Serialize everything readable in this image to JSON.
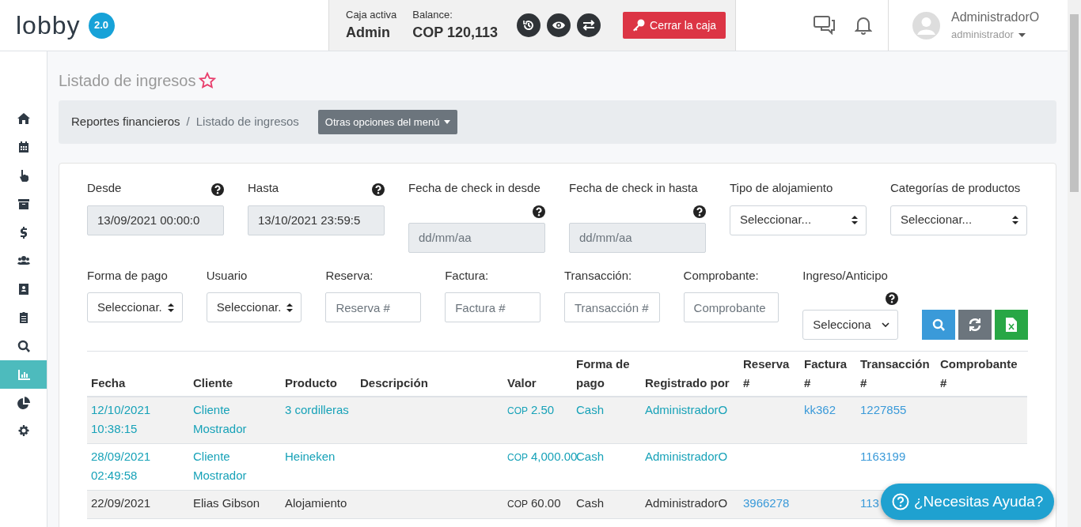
{
  "header": {
    "logo": "lobby",
    "version": "2.0",
    "cash_label": "Caja activa",
    "cash_value": "Admin",
    "balance_label": "Balance:",
    "balance_value": "COP 120,113",
    "close_button": "Cerrar la caja",
    "user_name": "AdministradorO",
    "user_role": "administrador"
  },
  "sidebar": {
    "items": [
      {
        "selected": false
      },
      {
        "selected": false
      },
      {
        "selected": false
      },
      {
        "selected": false
      },
      {
        "selected": false
      },
      {
        "selected": false
      },
      {
        "selected": false
      },
      {
        "selected": false
      },
      {
        "selected": false
      },
      {
        "selected": true
      },
      {
        "selected": false
      },
      {
        "selected": false
      }
    ]
  },
  "page": {
    "title": "Listado de ingresos",
    "favorite": false,
    "breadcrumb": [
      "Reportes financieros",
      "Listado de ingresos"
    ],
    "breadcrumb_separator": "/",
    "menu_button": "Otras opciones del menú"
  },
  "filters_row_1": [
    {
      "kind": "input",
      "label": "Desde",
      "help": true,
      "value": "13/09/2021 00:00:0",
      "readonly": true
    },
    {
      "kind": "input",
      "label": "Hasta",
      "help": true,
      "value": "13/10/2021 23:59:5",
      "readonly": true
    },
    {
      "kind": "input",
      "label": "Fecha de check in desde",
      "help": true,
      "placeholder": "dd/mm/aa",
      "readonly": true
    },
    {
      "kind": "input",
      "label": "Fecha de check in hasta",
      "help": true,
      "placeholder": "dd/mm/aa",
      "readonly": true
    },
    {
      "kind": "select",
      "label": "Tipo de alojamiento",
      "help": false,
      "value": "Seleccionar..."
    },
    {
      "kind": "select",
      "label": "Categorías de productos",
      "help": false,
      "value": "Seleccionar..."
    }
  ],
  "filters_row_2": [
    {
      "kind": "select",
      "label": "Forma de pago",
      "help": false,
      "value": "Seleccionar."
    },
    {
      "kind": "select",
      "label": "Usuario",
      "help": false,
      "value": "Seleccionar."
    },
    {
      "kind": "input",
      "label": "Reserva:",
      "help": false,
      "placeholder": "Reserva #",
      "readonly": false
    },
    {
      "kind": "input",
      "label": "Factura:",
      "help": false,
      "placeholder": "Factura #",
      "readonly": false
    },
    {
      "kind": "input",
      "label": "Transacción:",
      "help": false,
      "placeholder": "Transacción #",
      "readonly": false
    },
    {
      "kind": "input",
      "label": "Comprobante:",
      "help": false,
      "placeholder": "Comprobante",
      "readonly": false
    },
    {
      "kind": "dropdown",
      "label": "Ingreso/Anticipo",
      "help": true,
      "value": "Selecciona"
    }
  ],
  "table": {
    "columns": [
      "Fecha",
      "Cliente",
      "Producto",
      "Descripción",
      "Valor",
      "Forma de pago",
      "Registrado por",
      "Reserva #",
      "Factura #",
      "Transacción #",
      "Comprobante #"
    ],
    "rows": [
      {
        "linked": true,
        "fecha": "12/10/2021 10:38:15",
        "cliente": "Cliente Mostrador",
        "producto": "3 cordilleras",
        "descripcion": "",
        "currency": "COP",
        "amount": "2.50",
        "forma": "Cash",
        "registrado": "AdministradorO",
        "reserva": "",
        "factura": "kk362",
        "transaccion": "1227855",
        "comprobante": ""
      },
      {
        "linked": true,
        "fecha": "28/09/2021 02:49:58",
        "cliente": "Cliente Mostrador",
        "producto": "Heineken",
        "descripcion": "",
        "currency": "COP",
        "amount": "4,000.00",
        "forma": "Cash",
        "registrado": "AdministradorO",
        "reserva": "",
        "factura": "",
        "transaccion": "1163199",
        "comprobante": ""
      },
      {
        "linked": false,
        "fecha": "22/09/2021",
        "cliente": "Elias Gibson",
        "producto": "Alojamiento",
        "descripcion": "",
        "currency": "COP",
        "amount": "60.00",
        "forma": "Cash",
        "registrado": "AdministradorO",
        "reserva": "3966278",
        "factura": "",
        "transaccion": "113",
        "comprobante": ""
      }
    ]
  },
  "help_button": "¿Necesitas Ayuda?"
}
